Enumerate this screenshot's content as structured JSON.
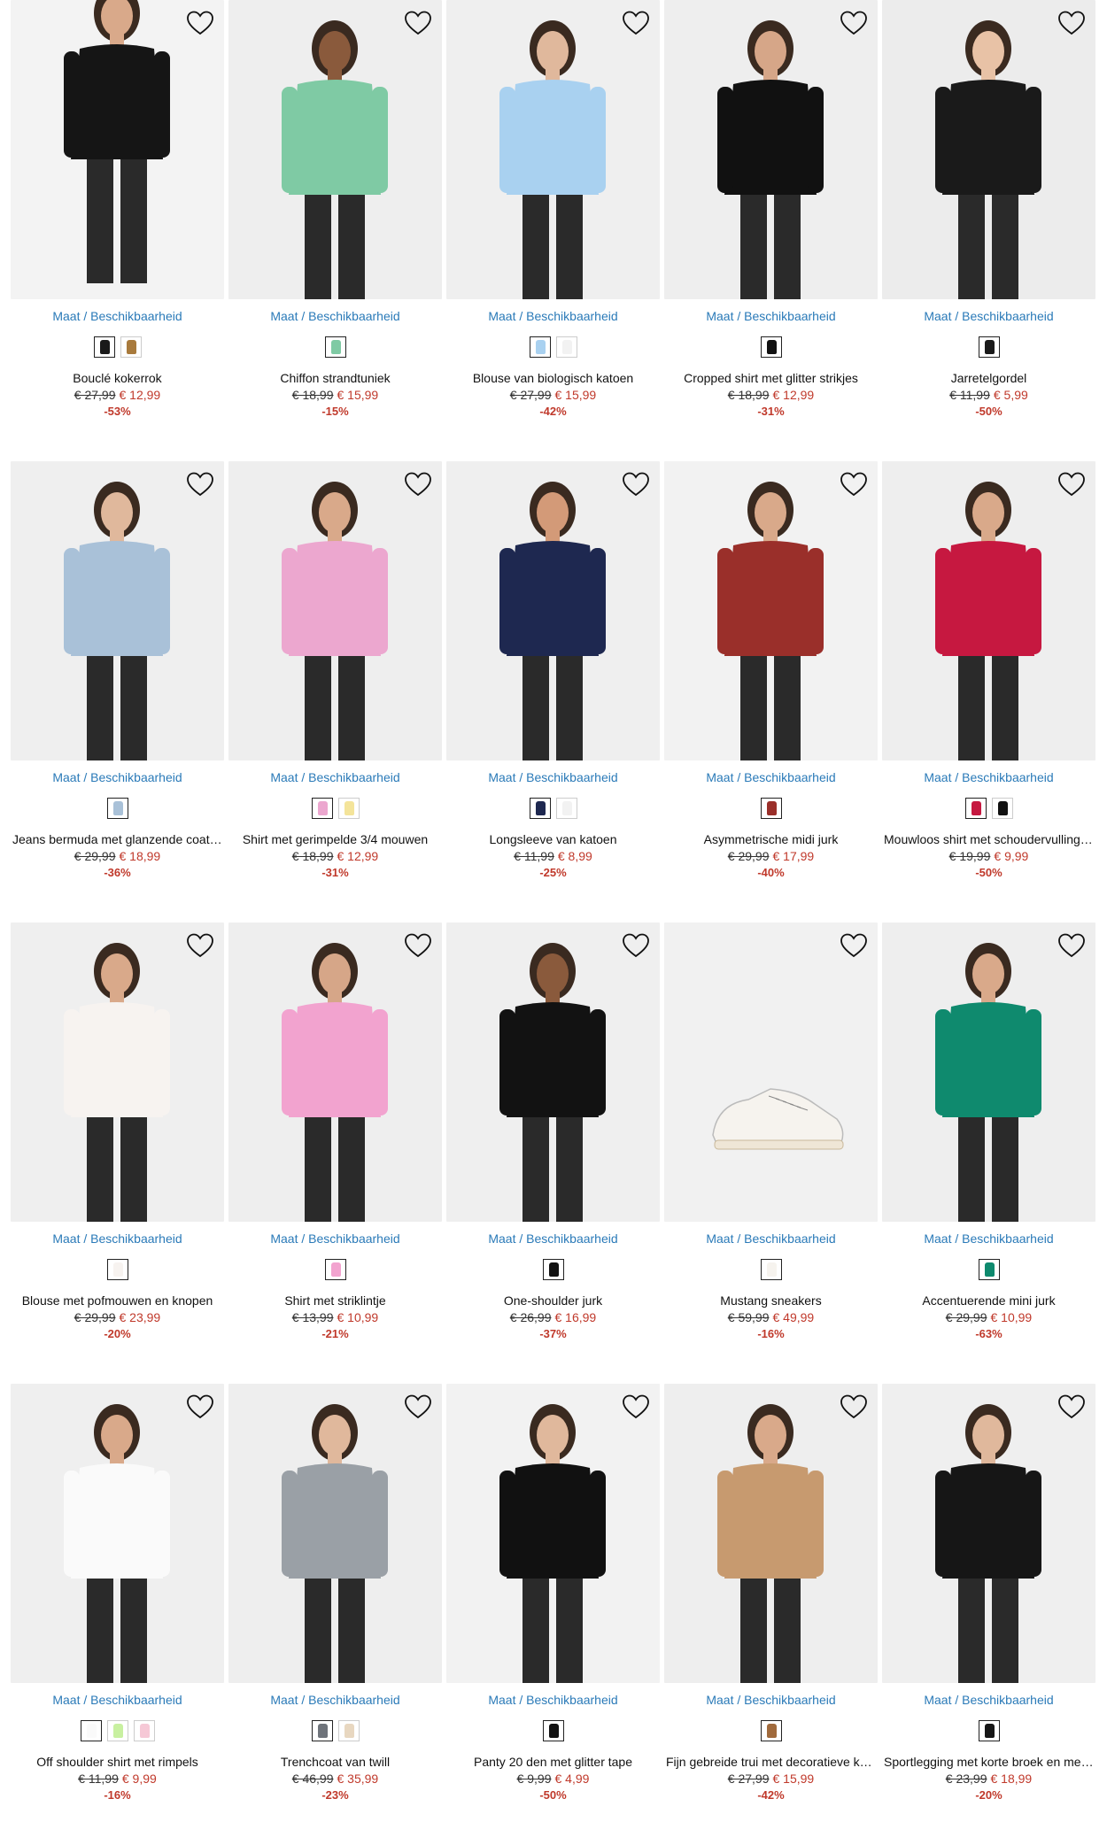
{
  "size_link_label": "Maat / Beschikbaarheid",
  "products": [
    {
      "name": "Bouclé kokerrok",
      "old_price": "€ 27,99",
      "new_price": "€ 12,99",
      "discount": "-53%",
      "bg": "#f3f3f3",
      "main": "#151515",
      "skin": "#d9a98a",
      "swatches": [
        "#1a1a1a",
        "#a87a3c"
      ]
    },
    {
      "name": "Chiffon strandtuniek",
      "old_price": "€ 18,99",
      "new_price": "€ 15,99",
      "discount": "-15%",
      "bg": "#eeeeee",
      "main": "#7fcaa4",
      "skin": "#8a5a3c",
      "swatches": [
        "#7fcaa4"
      ]
    },
    {
      "name": "Blouse van biologisch katoen",
      "old_price": "€ 27,99",
      "new_price": "€ 15,99",
      "discount": "-42%",
      "bg": "#efefef",
      "main": "#a9d1f0",
      "skin": "#e0b89c",
      "swatches": [
        "#a9d1f0",
        "#f2f2f2"
      ]
    },
    {
      "name": "Cropped shirt met glitter strikjes",
      "old_price": "€ 18,99",
      "new_price": "€ 12,99",
      "discount": "-31%",
      "bg": "#eeeeee",
      "main": "#111111",
      "skin": "#d6a688",
      "swatches": [
        "#111111"
      ]
    },
    {
      "name": "Jarretelgordel",
      "old_price": "€ 11,99",
      "new_price": "€ 5,99",
      "discount": "-50%",
      "bg": "#ececec",
      "main": "#1a1a1a",
      "skin": "#e8c2a6",
      "swatches": [
        "#1a1a1a"
      ]
    },
    {
      "name": "Jeans bermuda met glanzende coating",
      "old_price": "€ 29,99",
      "new_price": "€ 18,99",
      "discount": "-36%",
      "bg": "#efefef",
      "main": "#a9c1d8",
      "skin": "#e0b89c",
      "swatches": [
        "#a9c1d8"
      ]
    },
    {
      "name": "Shirt met gerimpelde 3/4 mouwen",
      "old_price": "€ 18,99",
      "new_price": "€ 12,99",
      "discount": "-31%",
      "bg": "#eeeeee",
      "main": "#eca7cf",
      "skin": "#d9a98a",
      "swatches": [
        "#eca7cf",
        "#f4e49a"
      ]
    },
    {
      "name": "Longsleeve van katoen",
      "old_price": "€ 11,99",
      "new_price": "€ 8,99",
      "discount": "-25%",
      "bg": "#efefef",
      "main": "#1e2850",
      "skin": "#d39a78",
      "swatches": [
        "#1e2850",
        "#f2f2f2"
      ]
    },
    {
      "name": "Asymmetrische midi jurk",
      "old_price": "€ 29,99",
      "new_price": "€ 17,99",
      "discount": "-40%",
      "bg": "#f2f2f2",
      "main": "#9a2f2a",
      "skin": "#d9a98a",
      "swatches": [
        "#9a2f2a"
      ]
    },
    {
      "name": "Mouwloos shirt met schoudervullingen",
      "old_price": "€ 19,99",
      "new_price": "€ 9,99",
      "discount": "-50%",
      "bg": "#eeeeee",
      "main": "#c61840",
      "skin": "#d9a98a",
      "swatches": [
        "#c61840",
        "#111111"
      ]
    },
    {
      "name": "Blouse met pofmouwen en knopen",
      "old_price": "€ 29,99",
      "new_price": "€ 23,99",
      "discount": "-20%",
      "bg": "#efefef",
      "main": "#f7f3f0",
      "skin": "#d9a98a",
      "swatches": [
        "#f7f3f0"
      ]
    },
    {
      "name": "Shirt met striklintje",
      "old_price": "€ 13,99",
      "new_price": "€ 10,99",
      "discount": "-21%",
      "bg": "#eeeeee",
      "main": "#f2a3cf",
      "skin": "#d6a688",
      "swatches": [
        "#f2a3cf"
      ]
    },
    {
      "name": "One-shoulder jurk",
      "old_price": "€ 26,99",
      "new_price": "€ 16,99",
      "discount": "-37%",
      "bg": "#efefef",
      "main": "#121212",
      "skin": "#8a5a3c",
      "swatches": [
        "#121212"
      ]
    },
    {
      "name": "Mustang sneakers",
      "old_price": "€ 59,99",
      "new_price": "€ 49,99",
      "discount": "-16%",
      "bg": "#f1f1f1",
      "main": "#f6f3ee",
      "skin": "#f1f1f1",
      "swatches": [
        "#f6f3ee"
      ]
    },
    {
      "name": "Accentuerende mini jurk",
      "old_price": "€ 29,99",
      "new_price": "€ 10,99",
      "discount": "-63%",
      "bg": "#eeeeee",
      "main": "#0f8a6e",
      "skin": "#d9a98a",
      "swatches": [
        "#0f8a6e"
      ]
    },
    {
      "name": "Off shoulder shirt met rimpels",
      "old_price": "€ 11,99",
      "new_price": "€ 9,99",
      "discount": "-16%",
      "bg": "#efefef",
      "main": "#fafafa",
      "skin": "#d9a98a",
      "swatches": [
        "#fafafa",
        "#c8f0a0",
        "#f6c8d6"
      ]
    },
    {
      "name": "Trenchcoat van twill",
      "old_price": "€ 46,99",
      "new_price": "€ 35,99",
      "discount": "-23%",
      "bg": "#eeeeee",
      "main": "#9aa0a6",
      "skin": "#e0b89c",
      "swatches": [
        "#6e737a",
        "#e8d7c0"
      ]
    },
    {
      "name": "Panty 20 den met glitter tape",
      "old_price": "€ 9,99",
      "new_price": "€ 4,99",
      "discount": "-50%",
      "bg": "#f2f2f2",
      "main": "#111111",
      "skin": "#e0b89c",
      "swatches": [
        "#111111"
      ]
    },
    {
      "name": "Fijn gebreide trui met decoratieve knopen",
      "old_price": "€ 27,99",
      "new_price": "€ 15,99",
      "discount": "-42%",
      "bg": "#eeeeee",
      "main": "#c79a6f",
      "skin": "#d9a98a",
      "swatches": [
        "#a06a3c"
      ]
    },
    {
      "name": "Sportlegging met korte broek en mesh",
      "old_price": "€ 23,99",
      "new_price": "€ 18,99",
      "discount": "-20%",
      "bg": "#efefef",
      "main": "#161616",
      "skin": "#e0b89c",
      "swatches": [
        "#161616"
      ]
    }
  ]
}
